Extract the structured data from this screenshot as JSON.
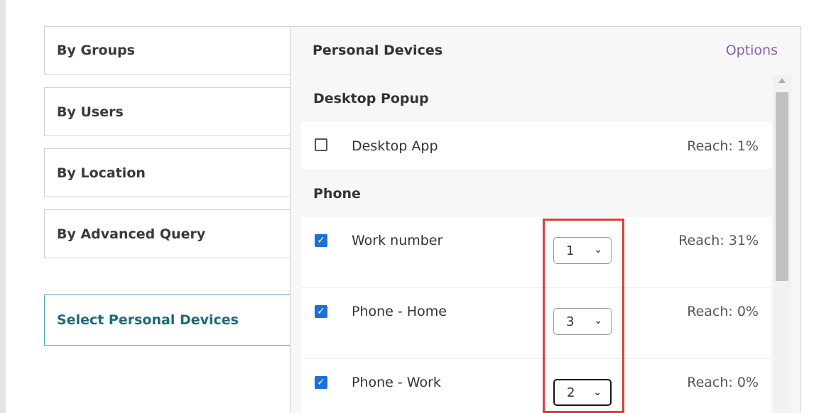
{
  "nav": {
    "tabs": [
      {
        "label": "By Groups"
      },
      {
        "label": "By Users"
      },
      {
        "label": "By Location"
      },
      {
        "label": "By Advanced Query"
      },
      {
        "label": "Select Personal Devices"
      }
    ],
    "active_tab": "Select Personal Devices"
  },
  "panel": {
    "title": "Personal Devices",
    "options_label": "Options",
    "groups": [
      {
        "header": "Desktop Popup",
        "devices": [
          {
            "name": "Desktop App",
            "checked": false,
            "reach": "Reach: 1%"
          }
        ]
      },
      {
        "header": "Phone",
        "devices": [
          {
            "name": "Work number",
            "checked": true,
            "priority": "1",
            "reach": "Reach: 31%"
          },
          {
            "name": "Phone - Home",
            "checked": true,
            "priority": "3",
            "reach": "Reach: 0%"
          },
          {
            "name": "Phone - Work",
            "checked": true,
            "priority": "2",
            "reach": "Reach: 0%"
          }
        ]
      }
    ]
  },
  "colors": {
    "options_link": "#8a5fae",
    "active_tab_border": "#4aa8b4",
    "active_tab_text": "#1e6a74",
    "checkbox_checked": "#1f6fd6",
    "highlight": "#d9403a"
  }
}
